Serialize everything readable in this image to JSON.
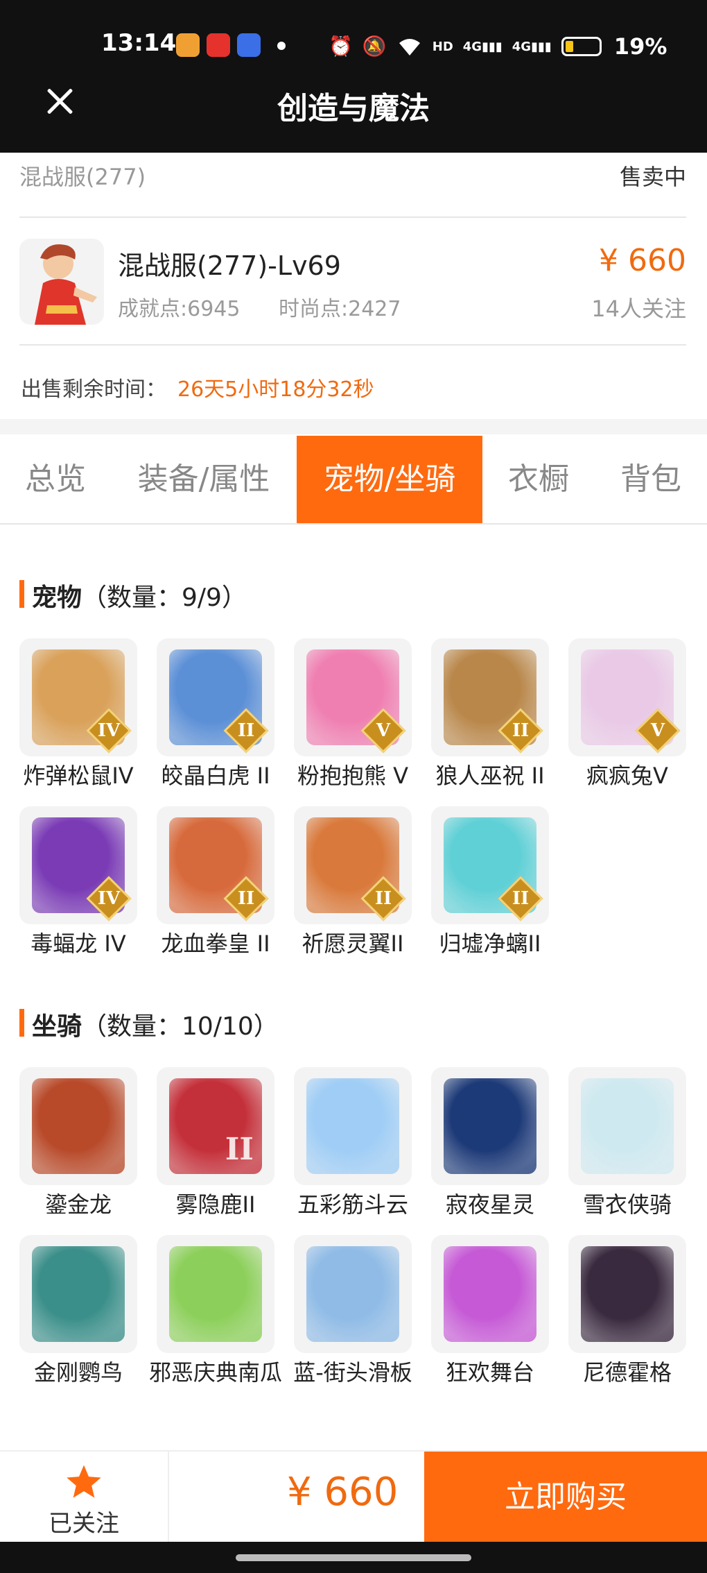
{
  "status_bar": {
    "time": "13:14",
    "battery_text": "19%",
    "battery_level": 0.19,
    "icons": [
      "photo-app-icon",
      "video-app-icon",
      "baidu-app-icon",
      "alarm-icon",
      "mute-icon",
      "wifi-icon",
      "hd-icon",
      "signal-4g-icon",
      "signal-4g-icon",
      "battery-icon"
    ]
  },
  "header": {
    "title": "创造与魔法"
  },
  "listing": {
    "server": "混战服(277)",
    "sale_status": "售卖中",
    "role_name": "混战服(277)-Lv69",
    "achievement": "成就点:6945",
    "fashion": "时尚点:2427",
    "price": "¥ 660",
    "followers": "14人关注",
    "remain_label": "出售剩余时间：",
    "remain_value": "26天5小时18分32秒"
  },
  "tabs": [
    {
      "label": "总览",
      "active": false
    },
    {
      "label": "装备/属性",
      "active": false
    },
    {
      "label": "宠物/坐骑",
      "active": true
    },
    {
      "label": "衣橱",
      "active": false
    },
    {
      "label": "背包",
      "active": false
    }
  ],
  "pets": {
    "title": "宠物",
    "count": "（数量：9/9）",
    "items": [
      {
        "name": "炸弹松鼠IV",
        "rank": "IV",
        "color": "#d9a15a"
      },
      {
        "name": "皎晶白虎 II",
        "rank": "II",
        "color": "#5b8fd6"
      },
      {
        "name": "粉抱抱熊 V",
        "rank": "V",
        "color": "#ef7fb1"
      },
      {
        "name": "狼人巫祝 II",
        "rank": "II",
        "color": "#b9874a"
      },
      {
        "name": "疯疯兔V",
        "rank": "V",
        "color": "#e9c9e6"
      },
      {
        "name": "毒蝠龙 IV",
        "rank": "IV",
        "color": "#7a3bb5"
      },
      {
        "name": "龙血拳皇 II",
        "rank": "II",
        "color": "#d76a3c"
      },
      {
        "name": "祈愿灵翼II",
        "rank": "II",
        "color": "#d97a3c"
      },
      {
        "name": "归墟净螭II",
        "rank": "II",
        "color": "#5fd0d6"
      }
    ]
  },
  "mounts": {
    "title": "坐骑",
    "count": "（数量：10/10）",
    "items": [
      {
        "name": "鎏金龙",
        "rank": "",
        "color": "#b84a2a"
      },
      {
        "name": "雾隐鹿II",
        "rank": "II",
        "color": "#c4303a"
      },
      {
        "name": "五彩筋斗云",
        "rank": "",
        "color": "#9fcdf5"
      },
      {
        "name": "寂夜星灵",
        "rank": "",
        "color": "#1d3a78"
      },
      {
        "name": "雪衣侠骑",
        "rank": "",
        "color": "#cfe9f0"
      },
      {
        "name": "金刚鹦鸟",
        "rank": "",
        "color": "#3b8f8a"
      },
      {
        "name": "邪恶庆典南瓜",
        "rank": "",
        "color": "#8ccf5a"
      },
      {
        "name": "蓝-街头滑板",
        "rank": "",
        "color": "#8fbbe6"
      },
      {
        "name": "狂欢舞台",
        "rank": "",
        "color": "#c65ad6"
      },
      {
        "name": "尼德霍格",
        "rank": "",
        "color": "#3a2a3f"
      }
    ]
  },
  "bottom_bar": {
    "follow_label": "已关注",
    "price": "¥ 660",
    "buy_label": "立即购买"
  }
}
